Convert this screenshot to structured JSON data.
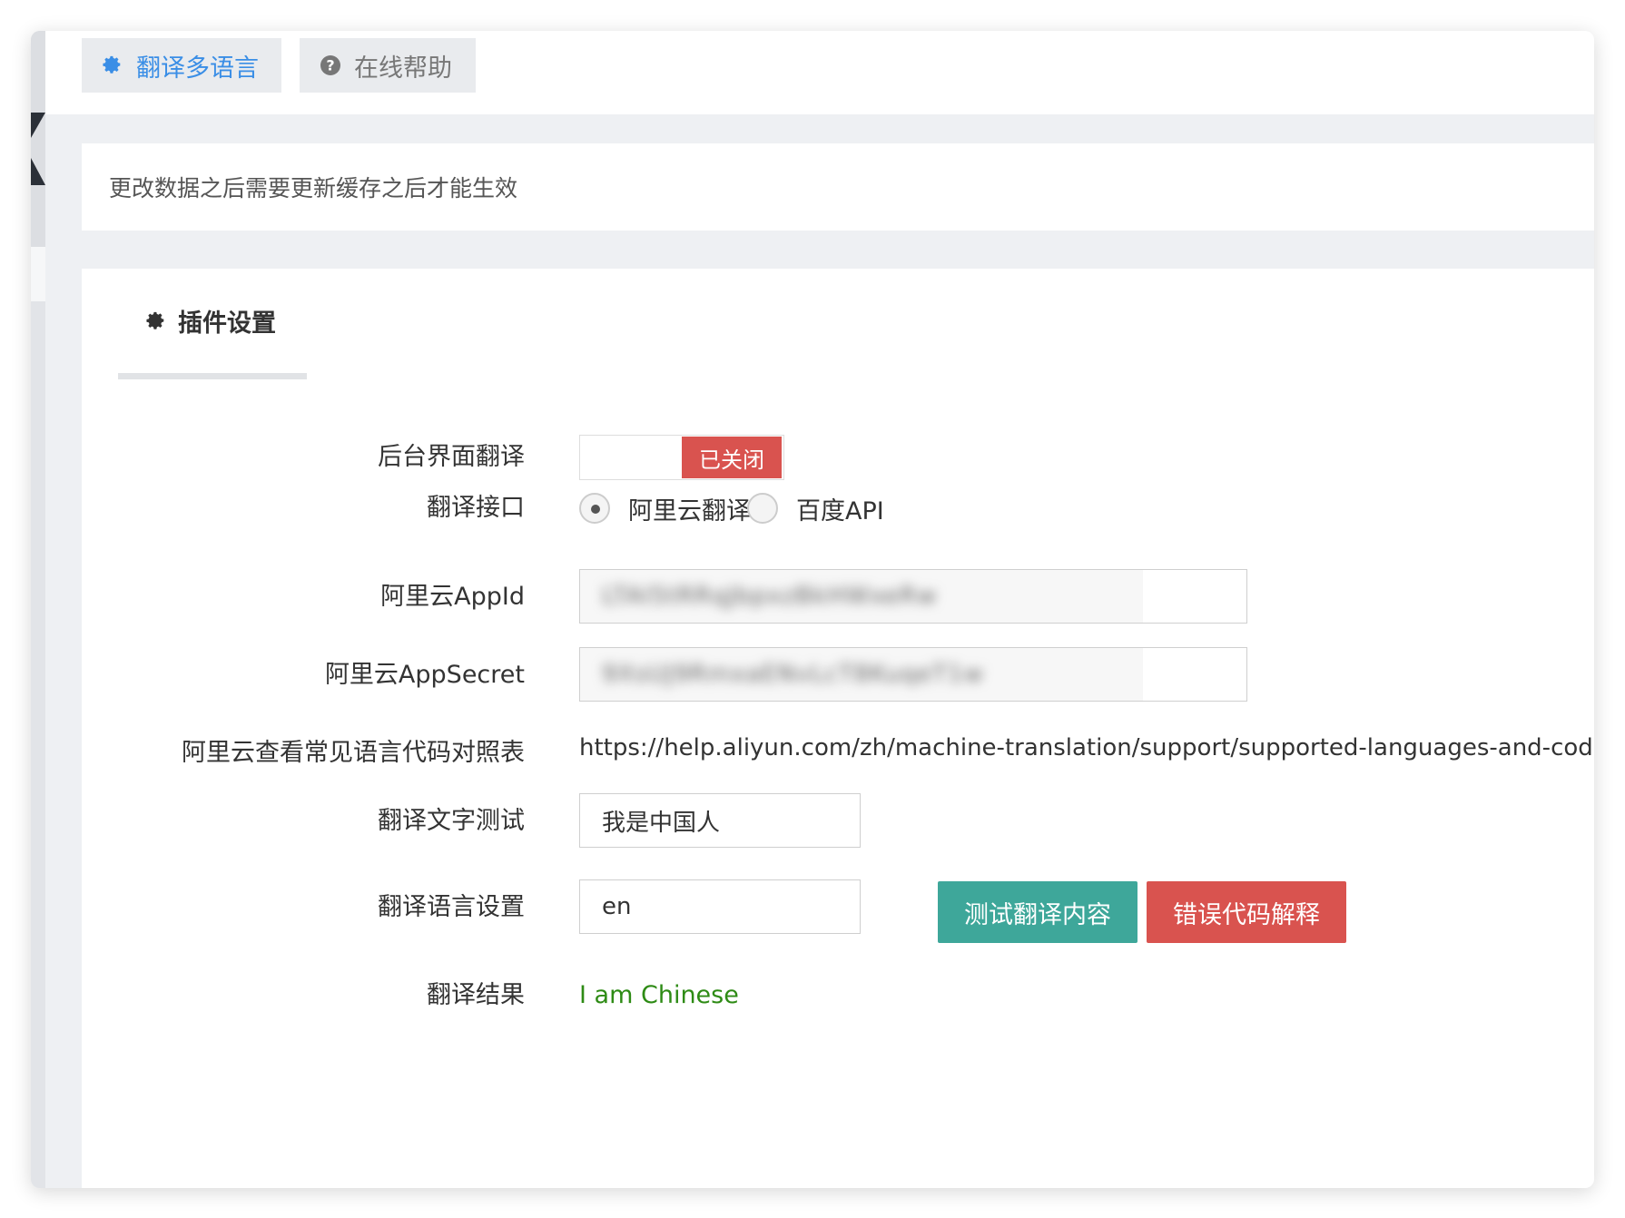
{
  "tabs": [
    {
      "label": "翻译多语言",
      "icon": "gear-icon",
      "active": true
    },
    {
      "label": "在线帮助",
      "icon": "question-circle-icon",
      "active": false
    }
  ],
  "notice": "更改数据之后需要更新缓存之后才能生效",
  "panel": {
    "tab_label": "插件设置",
    "tab_icon": "gear-icon"
  },
  "form": {
    "backend_translate": {
      "label": "后台界面翻译",
      "state": "已关闭"
    },
    "api": {
      "label": "翻译接口",
      "options": [
        "阿里云翻译",
        "百度API"
      ],
      "selected": "阿里云翻译"
    },
    "appid": {
      "label": "阿里云AppId",
      "value": "LTAI5tRRqJbpxzBkHWxeRw"
    },
    "appsecret": {
      "label": "阿里云AppSecret",
      "value": "9XsUJ9RmxaENvLcT8KuqeT1w"
    },
    "lang_table": {
      "label": "阿里云查看常见语言代码对照表",
      "url": "https://help.aliyun.com/zh/machine-translation/support/supported-languages-and-codes"
    },
    "test_text": {
      "label": "翻译文字测试",
      "value": "我是中国人"
    },
    "lang_setting": {
      "label": "翻译语言设置",
      "value": "en"
    },
    "test_button": "测试翻译内容",
    "error_button": "错误代码解释",
    "result": {
      "label": "翻译结果",
      "value": "I am Chinese"
    }
  },
  "colors": {
    "accent": "#3a8ee6",
    "danger": "#d9534f",
    "success_btn": "#3ea79a",
    "result_text": "#2e8b15"
  }
}
